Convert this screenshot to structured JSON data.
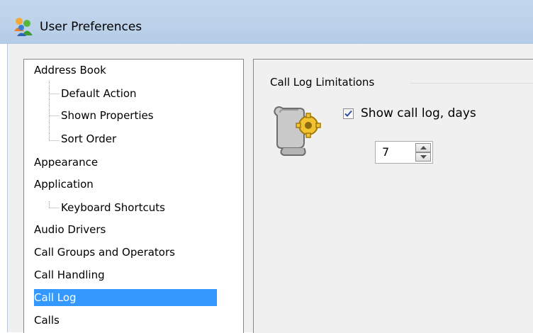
{
  "window": {
    "title": "User Preferences",
    "icon": "user-preferences-icon"
  },
  "tree": {
    "items": [
      {
        "label": "Address Book",
        "level": 0
      },
      {
        "label": "Default Action",
        "level": 1
      },
      {
        "label": "Shown Properties",
        "level": 1
      },
      {
        "label": "Sort Order",
        "level": 1
      },
      {
        "label": "Appearance",
        "level": 0
      },
      {
        "label": "Application",
        "level": 0
      },
      {
        "label": "Keyboard Shortcuts",
        "level": 1
      },
      {
        "label": "Audio Drivers",
        "level": 0
      },
      {
        "label": "Call Groups and Operators",
        "level": 0
      },
      {
        "label": "Call Handling",
        "level": 0
      },
      {
        "label": "Call Log",
        "level": 0,
        "selected": true
      },
      {
        "label": "Calls",
        "level": 0
      }
    ]
  },
  "content": {
    "group_title": "Call Log Limitations",
    "show_call_log": {
      "label": "Show call log, days",
      "checked": true
    },
    "days": {
      "value": "7"
    },
    "group_icon": "scroll-gear-icon"
  },
  "colors": {
    "selection": "#3399ff",
    "titlebar": "#bfd3ea",
    "panel": "#f0f0f0"
  }
}
